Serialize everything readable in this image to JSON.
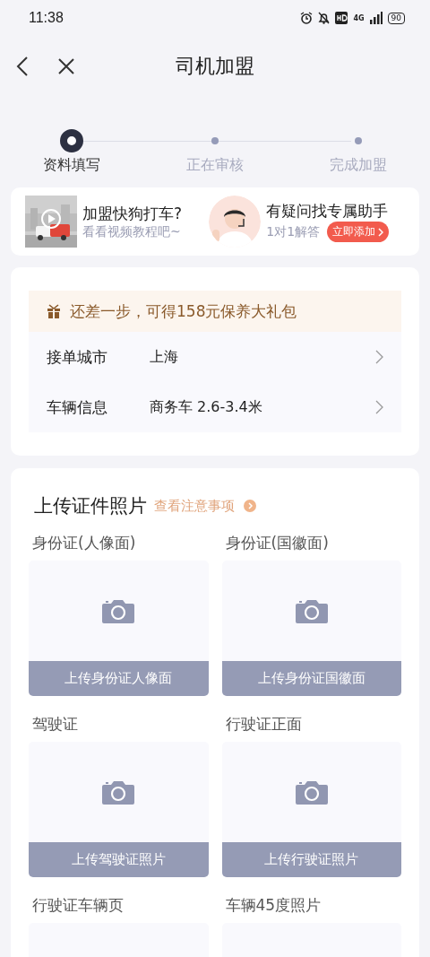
{
  "status_bar": {
    "time": "11:38",
    "battery": "90",
    "network": "4G"
  },
  "nav": {
    "title": "司机加盟"
  },
  "steps": [
    {
      "label": "资料填写",
      "selected": true
    },
    {
      "label": "正在审核",
      "selected": false
    },
    {
      "label": "完成加盟",
      "selected": false
    }
  ],
  "promo": {
    "video": {
      "kind": "picture",
      "title": "加盟快狗打车?",
      "subtitle": "看看视频教程吧~"
    },
    "helper": {
      "kind": "picture",
      "title": "有疑问找专属助手",
      "subtitle": "1对1解答",
      "button": "立即添加"
    }
  },
  "info_card": {
    "notice": "还差一步，可得158元保养大礼包",
    "rows": [
      {
        "label": "接单城市",
        "value": "上海"
      },
      {
        "label": "车辆信息",
        "value": "商务车 2.6-3.4米"
      }
    ]
  },
  "upload": {
    "title": "上传证件照片",
    "link": "查看注意事项",
    "items": [
      {
        "label": "身份证(人像面)",
        "button": "上传身份证人像面"
      },
      {
        "label": "身份证(国徽面)",
        "button": "上传身份证国徽面"
      },
      {
        "label": "驾驶证",
        "button": "上传驾驶证照片"
      },
      {
        "label": "行驶证正面",
        "button": "上传行驶证照片"
      },
      {
        "label": "行驶证车辆页"
      },
      {
        "label": "车辆45度照片"
      }
    ]
  }
}
